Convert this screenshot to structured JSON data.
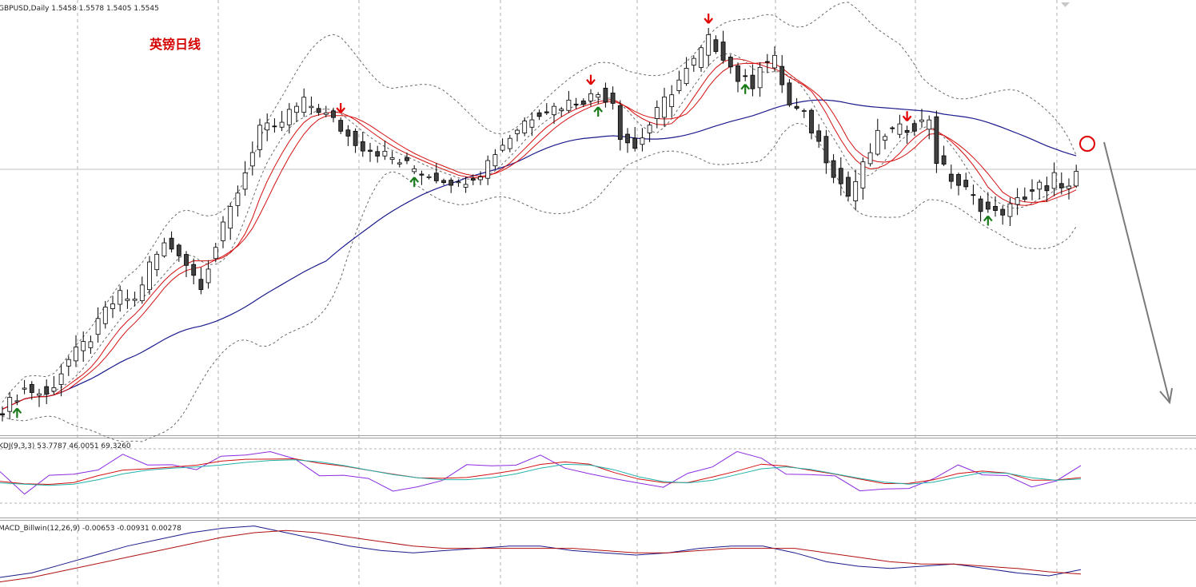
{
  "header": {
    "symbol_info": "GBPUSD,Daily  1.5458 1.5578 1.5405 1.5545",
    "annotation": "英镑日线"
  },
  "kdj_panel": {
    "label": "KDJ(9,3,3) 53.7787 46.0051 69.3260"
  },
  "macd_panel": {
    "label": "MACD_Billwin(12,26,9) -0.00653 -0.00931 0.00278"
  },
  "colors": {
    "background": "#ffffff",
    "grid": "#b0b0b0",
    "candle_up": "#ffffff",
    "candle_down": "#404040",
    "candle_outline": "#000000",
    "ma_short": "#d41010",
    "ma_long": "#1a1a8c",
    "bollinger": "#6a6a6a",
    "arrow_up": "#1a7a1a",
    "arrow_down": "#e00000",
    "circle": "#e00000",
    "forecast_arrow": "#7a7a7a",
    "kdj_k": "#8a2be2",
    "kdj_d": "#d41010",
    "kdj_j": "#20b2aa",
    "macd_main": "#1a1a8c",
    "macd_signal": "#b01010"
  },
  "chart_data": {
    "type": "candlestick",
    "symbol": "GBPUSD",
    "timeframe": "Daily",
    "ohlc_last": {
      "open": 1.5458,
      "high": 1.5578,
      "low": 1.5405,
      "close": 1.5545
    },
    "overlays": [
      "moving-average-short-pair",
      "moving-average-long",
      "bollinger-bands"
    ],
    "close_path": [
      [
        0,
        1.536
      ],
      [
        3,
        1.548
      ],
      [
        6,
        1.544
      ],
      [
        9,
        1.565
      ],
      [
        12,
        1.578
      ],
      [
        14,
        1.594
      ],
      [
        16,
        1.603
      ],
      [
        18,
        1.6
      ],
      [
        20,
        1.621
      ],
      [
        22,
        1.633
      ],
      [
        24,
        1.629
      ],
      [
        26,
        1.615
      ],
      [
        27,
        1.61
      ],
      [
        29,
        1.632
      ],
      [
        31,
        1.654
      ],
      [
        33,
        1.676
      ],
      [
        35,
        1.703
      ],
      [
        37,
        1.7
      ],
      [
        39,
        1.711
      ],
      [
        41,
        1.717
      ],
      [
        43,
        1.713
      ],
      [
        45,
        1.706
      ],
      [
        47,
        1.697
      ],
      [
        49,
        1.691
      ],
      [
        51,
        1.688
      ],
      [
        53,
        1.684
      ],
      [
        55,
        1.68
      ],
      [
        57,
        1.676
      ],
      [
        59,
        1.673
      ],
      [
        61,
        1.671
      ],
      [
        62,
        1.668
      ],
      [
        63,
        1.672
      ],
      [
        65,
        1.676
      ],
      [
        67,
        1.688
      ],
      [
        69,
        1.697
      ],
      [
        71,
        1.706
      ],
      [
        73,
        1.712
      ],
      [
        75,
        1.714
      ],
      [
        77,
        1.717
      ],
      [
        79,
        1.719
      ],
      [
        81,
        1.722
      ],
      [
        83,
        1.718
      ],
      [
        84,
        1.698
      ],
      [
        86,
        1.69
      ],
      [
        88,
        1.704
      ],
      [
        90,
        1.718
      ],
      [
        92,
        1.73
      ],
      [
        94,
        1.741
      ],
      [
        96,
        1.754
      ],
      [
        98,
        1.745
      ],
      [
        100,
        1.731
      ],
      [
        102,
        1.728
      ],
      [
        103,
        1.74
      ],
      [
        105,
        1.742
      ],
      [
        107,
        1.715
      ],
      [
        109,
        1.709
      ],
      [
        111,
        1.693
      ],
      [
        113,
        1.676
      ],
      [
        115,
        1.662
      ],
      [
        117,
        1.679
      ],
      [
        119,
        1.697
      ],
      [
        121,
        1.7
      ],
      [
        123,
        1.702
      ],
      [
        125,
        1.705
      ],
      [
        126,
        1.708
      ],
      [
        127,
        1.683
      ],
      [
        129,
        1.672
      ],
      [
        131,
        1.665
      ],
      [
        133,
        1.656
      ],
      [
        135,
        1.651
      ],
      [
        137,
        1.655
      ],
      [
        139,
        1.662
      ],
      [
        141,
        1.668
      ],
      [
        142,
        1.663
      ],
      [
        143,
        1.673
      ],
      [
        145,
        1.666
      ],
      [
        146,
        1.674
      ]
    ],
    "signals_up_index": [
      2,
      56,
      81,
      101,
      134
    ],
    "signals_down_index": [
      46,
      80,
      96,
      123
    ],
    "kdj_series": [
      {
        "name": "K",
        "values": [
          46,
          30,
          35,
          42,
          60,
          70,
          68,
          62,
          64,
          72,
          80,
          82,
          78,
          60,
          55,
          45,
          40,
          42,
          44,
          52,
          58,
          72,
          84,
          70,
          50,
          30,
          25,
          32,
          45,
          60,
          74,
          78,
          60,
          45,
          40,
          32,
          28,
          40,
          56,
          72,
          62,
          40,
          30,
          44,
          54
        ]
      },
      {
        "name": "D",
        "values": [
          40,
          36,
          36,
          40,
          50,
          58,
          62,
          64,
          66,
          70,
          74,
          76,
          76,
          70,
          64,
          56,
          50,
          46,
          44,
          46,
          50,
          58,
          68,
          70,
          66,
          55,
          44,
          40,
          40,
          48,
          58,
          66,
          64,
          58,
          50,
          44,
          38,
          38,
          44,
          54,
          58,
          52,
          44,
          44,
          48
        ]
      }
    ],
    "macd_series": [
      {
        "name": "MACD",
        "values": [
          -0.01,
          -0.008,
          -0.004,
          0.0,
          0.004,
          0.007,
          0.01,
          0.012,
          0.013,
          0.01,
          0.007,
          0.004,
          0.002,
          0.001,
          0.002,
          0.003,
          0.004,
          0.004,
          0.002,
          0.001,
          0.0,
          0.001,
          0.003,
          0.004,
          0.004,
          0.001,
          -0.003,
          -0.005,
          -0.006,
          -0.005,
          -0.004,
          -0.006,
          -0.008,
          -0.0093,
          -0.0065
        ]
      },
      {
        "name": "Signal",
        "values": [
          -0.012,
          -0.01,
          -0.007,
          -0.004,
          -0.001,
          0.002,
          0.005,
          0.008,
          0.01,
          0.011,
          0.01,
          0.008,
          0.006,
          0.004,
          0.003,
          0.003,
          0.003,
          0.003,
          0.003,
          0.002,
          0.001,
          0.001,
          0.002,
          0.003,
          0.003,
          0.003,
          0.001,
          -0.001,
          -0.003,
          -0.004,
          -0.004,
          -0.005,
          -0.006,
          -0.0075,
          -0.0085
        ]
      }
    ]
  }
}
